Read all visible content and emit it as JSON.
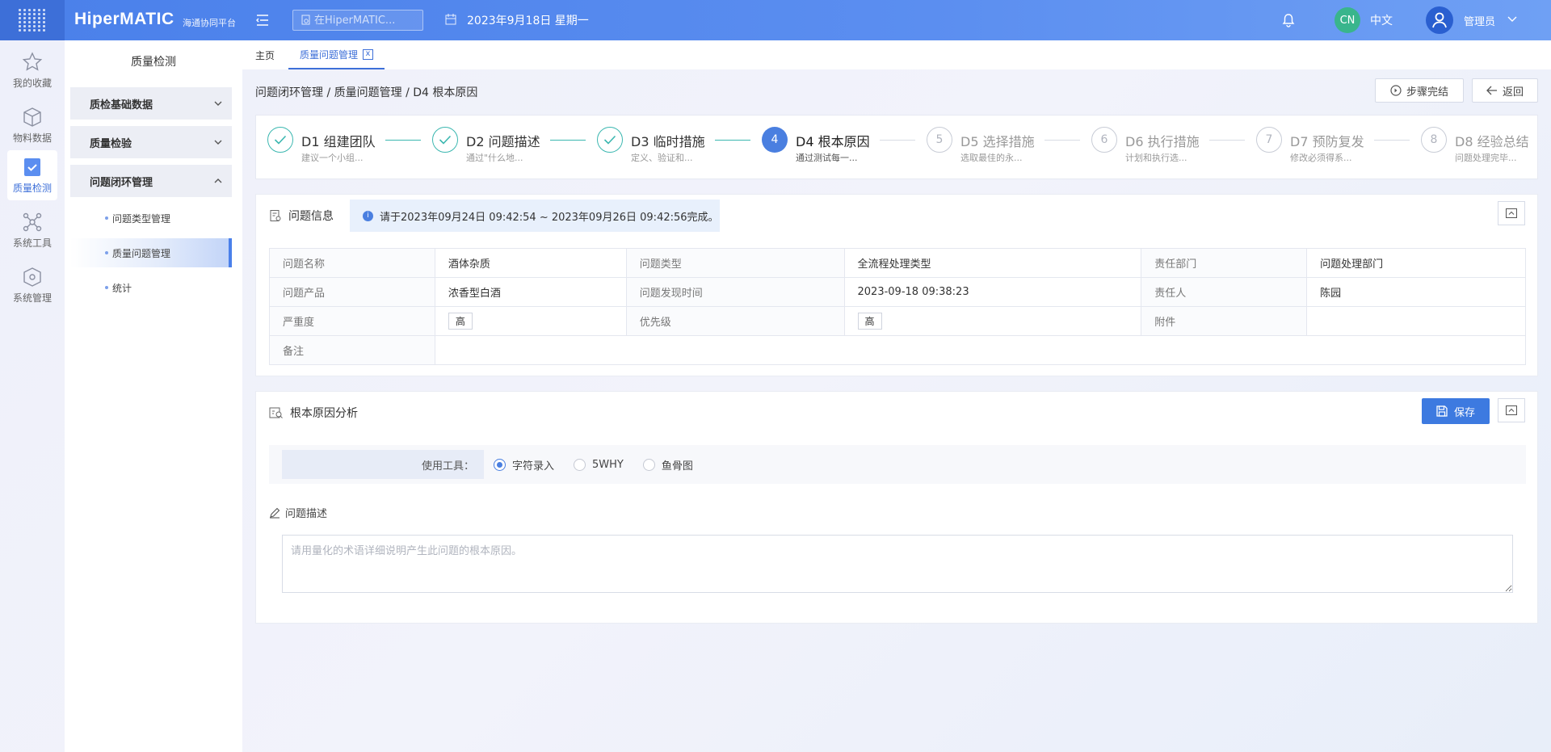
{
  "header": {
    "logo": "HiperMATIC",
    "logo_sub": "海通协同平台",
    "search_placeholder": "在HiperMATIC...",
    "date": "2023年9月18日 星期一",
    "lang_badge": "CN",
    "lang": "中文",
    "username": "管理员"
  },
  "rail": [
    {
      "label": "我的收藏",
      "icon": "star-icon"
    },
    {
      "label": "物料数据",
      "icon": "cube-icon"
    },
    {
      "label": "质量检测",
      "icon": "shield-check-icon"
    },
    {
      "label": "系统工具",
      "icon": "network-icon"
    },
    {
      "label": "系统管理",
      "icon": "box-icon"
    }
  ],
  "sidebar": {
    "title": "质量检测",
    "groups": [
      {
        "label": "质检基础数据",
        "expanded": false
      },
      {
        "label": "质量检验",
        "expanded": false
      },
      {
        "label": "问题闭环管理",
        "expanded": true
      }
    ],
    "subitems": [
      {
        "label": "问题类型管理"
      },
      {
        "label": "质量问题管理",
        "active": true
      },
      {
        "label": "统计"
      }
    ]
  },
  "tabs": [
    {
      "label": "主页"
    },
    {
      "label": "质量问题管理",
      "active": true,
      "close": "x"
    }
  ],
  "breadcrumb": {
    "text": "问题闭环管理 / 质量问题管理 / D4 根本原因"
  },
  "actions": {
    "complete_step": "步骤完结",
    "back": "返回"
  },
  "steps": [
    {
      "num": "1",
      "title": "D1 组建团队",
      "desc": "建议一个小组...",
      "status": "done"
    },
    {
      "num": "2",
      "title": "D2 问题描述",
      "desc": "通过\"什么地...",
      "status": "done"
    },
    {
      "num": "3",
      "title": "D3 临时措施",
      "desc": "定义、验证和...",
      "status": "done"
    },
    {
      "num": "4",
      "title": "D4 根本原因",
      "desc": "通过测试每一...",
      "status": "current"
    },
    {
      "num": "5",
      "title": "D5 选择措施",
      "desc": "选取最佳的永...",
      "status": "todo"
    },
    {
      "num": "6",
      "title": "D6 执行措施",
      "desc": "计划和执行选...",
      "status": "todo"
    },
    {
      "num": "7",
      "title": "D7 预防复发",
      "desc": "修改必须得系...",
      "status": "todo"
    },
    {
      "num": "8",
      "title": "D8 经验总结",
      "desc": "问题处理完毕...",
      "status": "todo"
    }
  ],
  "problem_info": {
    "title": "问题信息",
    "notice": "请于2023年09月24日 09:42:54 ~ 2023年09月26日 09:42:56完成。",
    "rows": [
      [
        "问题名称",
        "酒体杂质",
        "问题类型",
        "全流程处理类型",
        "责任部门",
        "问题处理部门"
      ],
      [
        "问题产品",
        "浓香型白酒",
        "问题发现时间",
        "2023-09-18 09:38:23",
        "责任人",
        "陈园"
      ],
      [
        "严重度",
        "高",
        "优先级",
        "高",
        "附件",
        ""
      ],
      [
        "备注",
        ""
      ]
    ]
  },
  "root_cause": {
    "title": "根本原因分析",
    "save": "保存",
    "tool_label": "使用工具：",
    "tools": [
      {
        "label": "字符录入",
        "selected": true
      },
      {
        "label": "5WHY",
        "selected": false
      },
      {
        "label": "鱼骨图",
        "selected": false
      }
    ],
    "desc_label": "问题描述",
    "desc_placeholder": "请用量化的术语详细说明产生此问题的根本原因。"
  },
  "colors": {
    "primary": "#4a80ea",
    "done": "#3bb7b0",
    "current": "#4a7fe0"
  }
}
